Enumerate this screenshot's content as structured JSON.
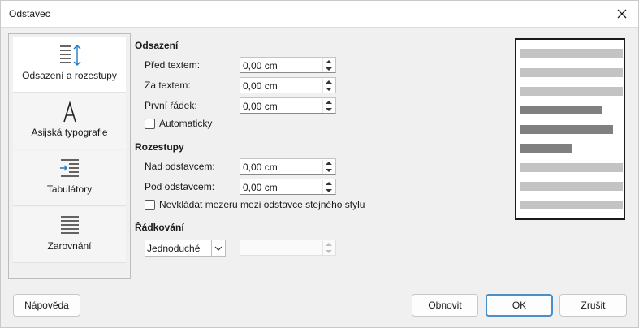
{
  "dialog": {
    "title": "Odstavec"
  },
  "sidebar": {
    "tabs": [
      {
        "label": "Odsazení a rozestupy",
        "icon": "indent-spacing-icon"
      },
      {
        "label": "Asijská typografie",
        "icon": "asian-typography-icon"
      },
      {
        "label": "Tabulátory",
        "icon": "tabs-icon"
      },
      {
        "label": "Zarovnání",
        "icon": "alignment-icon"
      }
    ]
  },
  "indent": {
    "heading": "Odsazení",
    "before_label": "Před textem:",
    "before_value": "0,00 cm",
    "after_label": "Za textem:",
    "after_value": "0,00 cm",
    "first_label": "První řádek:",
    "first_value": "0,00 cm",
    "auto_label": "Automaticky"
  },
  "spacing": {
    "heading": "Rozestupy",
    "above_label": "Nad odstavcem:",
    "above_value": "0,00 cm",
    "below_label": "Pod odstavcem:",
    "below_value": "0,00 cm",
    "no_space_label": "Nevkládat mezeru mezi odstavce stejného stylu"
  },
  "line_spacing": {
    "heading": "Řádkování",
    "selected": "Jednoduché",
    "value": ""
  },
  "buttons": {
    "help": "Nápověda",
    "reset": "Obnovit",
    "ok": "OK",
    "cancel": "Zrušit"
  },
  "colors": {
    "preview_light": "#c3c3c3",
    "preview_dark": "#808080",
    "ok_border": "#4a8fc9"
  }
}
